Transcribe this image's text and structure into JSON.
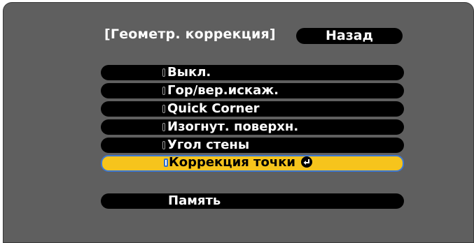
{
  "header": {
    "title": "[Геометр. коррекция]",
    "back_label": "Назад"
  },
  "menu": {
    "items": [
      {
        "label": "Выкл."
      },
      {
        "label": "Гор/вер.искаж."
      },
      {
        "label": "Quick Corner"
      },
      {
        "label": "Изогнут. поверхн."
      },
      {
        "label": "Угол стены"
      },
      {
        "label": "Коррекция точки"
      }
    ],
    "selected_index": 5,
    "memory_label": "Память"
  },
  "colors": {
    "background": "#5f5f5f",
    "item": "#000000",
    "selected": "#f6c41c",
    "selected_border": "#3d78d2"
  },
  "icons": {
    "selected_item_icon": "enter-icon"
  }
}
